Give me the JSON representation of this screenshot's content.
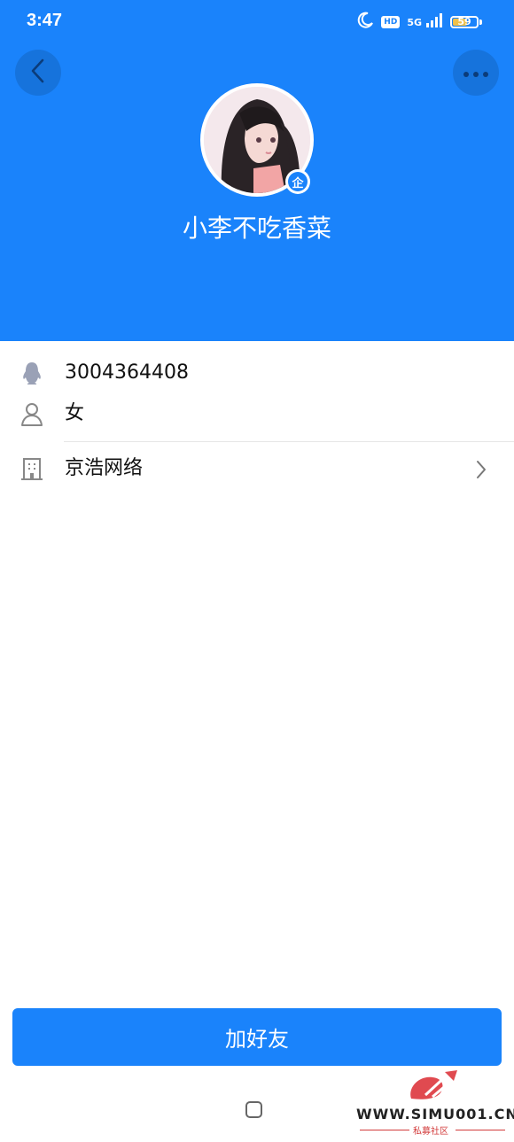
{
  "status_bar": {
    "time": "3:47",
    "hd": "HD",
    "network": "5G",
    "battery": "59",
    "battery_level": 0.59
  },
  "header": {
    "nickname": "小李不吃香菜",
    "enterprise_badge": "企",
    "background_color": "#1a83fb"
  },
  "info": {
    "qq_number": "3004364408",
    "gender": "女",
    "company": "京浩网络"
  },
  "actions": {
    "add_friend_label": "加好友"
  },
  "watermark": {
    "url": "WWW.SIMU001.CN",
    "subtitle": "私募社区"
  }
}
